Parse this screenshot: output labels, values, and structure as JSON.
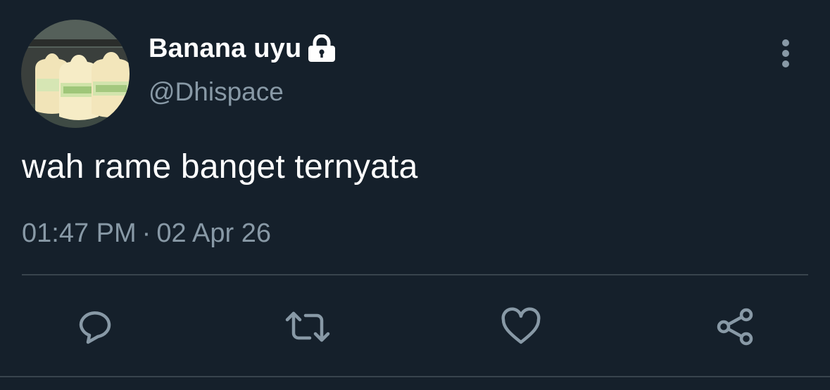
{
  "tweet": {
    "author": {
      "display_name": "Banana uyu",
      "handle": "@Dhispace",
      "protected": true,
      "avatar_icon": "banana-milk-bottles-avatar"
    },
    "text": "wah rame banget ternyata",
    "time": "01:47 PM",
    "separator": "·",
    "date": "02 Apr 26"
  },
  "actions": [
    {
      "name": "reply",
      "icon": "comment-bubble-icon"
    },
    {
      "name": "retweet",
      "icon": "retweet-icon"
    },
    {
      "name": "like",
      "icon": "heart-icon"
    },
    {
      "name": "share",
      "icon": "share-icon"
    }
  ],
  "menu": {
    "icon": "more-vertical-icon"
  },
  "colors": {
    "background": "#15202b",
    "primary_text": "#ffffff",
    "secondary_text": "#8899a6",
    "divider": "#38444d",
    "icon": "#8899a6"
  }
}
